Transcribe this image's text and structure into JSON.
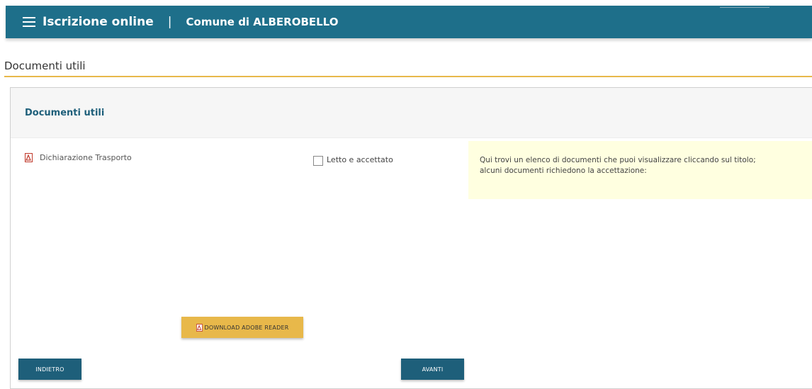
{
  "header": {
    "app_title": "Iscrizione online",
    "separator": "|",
    "comune": "Comune di ALBEROBELLO",
    "bar_color": "#1e6f8a"
  },
  "page": {
    "heading": "Documenti utili",
    "accent_color": "#e8b84a"
  },
  "panel": {
    "title": "Documenti utili",
    "documents": [
      {
        "icon": "pdf-icon",
        "name": "Dichiarazione Trasporto",
        "checkbox_label": "Letto e accettato",
        "checked": false
      }
    ],
    "info_line1": "Qui trovi un elenco di documenti che puoi visualizzare cliccando sul titolo;",
    "info_line2": "alcuni documenti richiedono la accettazione:"
  },
  "buttons": {
    "download": "DOWNLOAD ADOBE READER",
    "back": "INDIETRO",
    "next": "AVANTI"
  }
}
